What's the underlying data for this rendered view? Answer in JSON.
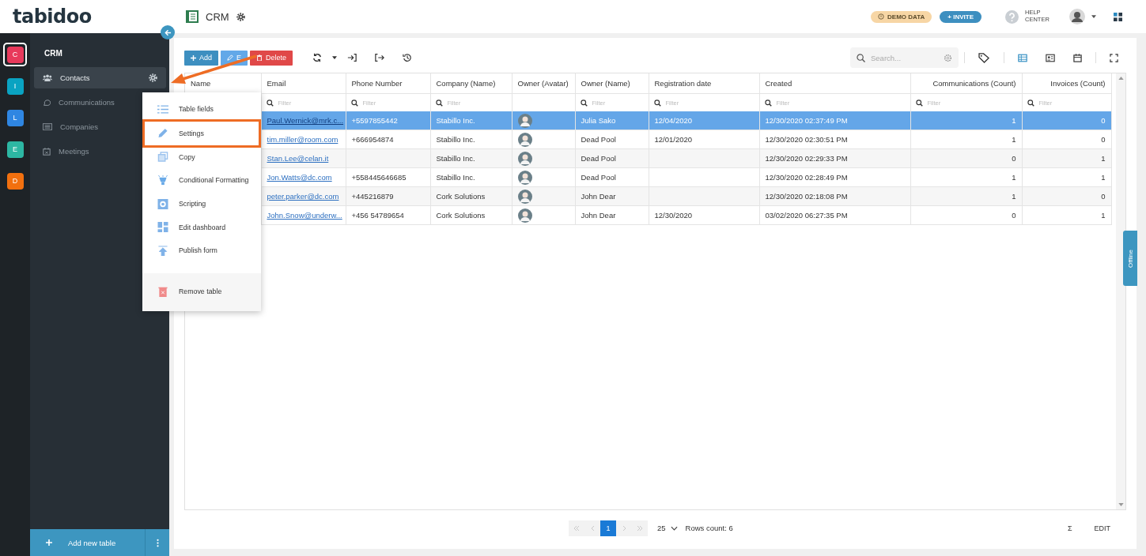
{
  "header": {
    "logo": "tabidoo",
    "app_title": "CRM",
    "demo_badge": "DEMO DATA",
    "invite_button": "+ INVITE",
    "help": "HELP CENTER"
  },
  "apps": [
    {
      "letter": "C",
      "color": "#e8395b",
      "selected": true
    },
    {
      "letter": "I",
      "color": "#0aa3c2",
      "selected": false
    },
    {
      "letter": "L",
      "color": "#2f86e2",
      "selected": false
    },
    {
      "letter": "E",
      "color": "#2db7a3",
      "selected": false
    },
    {
      "letter": "D",
      "color": "#f2700f",
      "selected": false
    }
  ],
  "nav": {
    "title": "CRM",
    "items": [
      {
        "label": "Contacts",
        "selected": true
      },
      {
        "label": "Communications",
        "selected": false
      },
      {
        "label": "Companies",
        "selected": false
      },
      {
        "label": "Meetings",
        "selected": false
      }
    ],
    "add_table": "Add new table"
  },
  "toolbar": {
    "buttons": [
      {
        "label": "Add",
        "kind": "add"
      },
      {
        "label": "E",
        "kind": "edit"
      },
      {
        "label": "Delete",
        "kind": "delete"
      }
    ],
    "search_placeholder": "Search..."
  },
  "menu": {
    "items": [
      {
        "label": "Table fields",
        "highlighted": false
      },
      {
        "label": "Settings",
        "highlighted": true
      },
      {
        "label": "Copy",
        "highlighted": false
      },
      {
        "label": "Conditional Formatting",
        "highlighted": false
      },
      {
        "label": "Scripting",
        "highlighted": false
      },
      {
        "label": "Edit dashboard",
        "highlighted": false
      },
      {
        "label": "Publish form",
        "highlighted": false
      }
    ],
    "footer_item": "Remove table"
  },
  "table": {
    "columns": [
      {
        "label": "Name"
      },
      {
        "label": "Email",
        "placeholder": "Filter"
      },
      {
        "label": "Phone Number",
        "placeholder": "Filter"
      },
      {
        "label": "Company (Name)",
        "placeholder": "Filter"
      },
      {
        "label": "Owner (Avatar)"
      },
      {
        "label": "Owner (Name)",
        "placeholder": "Filter"
      },
      {
        "label": "Registration date",
        "placeholder": "Filter"
      },
      {
        "label": "Created",
        "placeholder": "Filter"
      },
      {
        "label": "Communications (Count)",
        "placeholder": "Filter"
      },
      {
        "label": "Invoices (Count)",
        "placeholder": "Filter"
      }
    ],
    "rows": [
      {
        "selected": true,
        "email": "Paul.Wernick@mrk.c...",
        "phone": "+5597855442",
        "company": "Stabillo Inc.",
        "owner": "Julia Sako",
        "registration": "12/04/2020",
        "created": "12/30/2020 02:37:49 PM",
        "communications": "1",
        "invoices": "0"
      },
      {
        "selected": false,
        "email": "tim.miller@room.com",
        "phone": "+666954874",
        "company": "Stabillo Inc.",
        "owner": "Dead Pool",
        "registration": "12/01/2020",
        "created": "12/30/2020 02:30:51 PM",
        "communications": "1",
        "invoices": "0"
      },
      {
        "selected": false,
        "email": "Stan.Lee@celan.it",
        "company": "Stabillo Inc.",
        "owner": "Dead Pool",
        "created": "12/30/2020 02:29:33 PM",
        "communications": "0",
        "invoices": "1"
      },
      {
        "selected": false,
        "email": "Jon.Watts@dc.com",
        "phone": "+558445646685",
        "company": "Stabillo Inc.",
        "owner": "Dead Pool",
        "created": "12/30/2020 02:28:49 PM",
        "communications": "1",
        "invoices": "1"
      },
      {
        "selected": false,
        "email": "peter.parker@dc.com",
        "phone": "+445216879",
        "company": "Cork Solutions",
        "owner": "John Dear",
        "created": "12/30/2020 02:18:08 PM",
        "communications": "1",
        "invoices": "0"
      },
      {
        "selected": false,
        "email": "John.Snow@underw...",
        "phone": "+456 54789654",
        "company": "Cork Solutions",
        "owner": "John Dear",
        "registration": "12/30/2020",
        "created": "03/02/2020 06:27:35 PM",
        "communications": "0",
        "invoices": "1"
      }
    ]
  },
  "pager": {
    "pages": [
      {
        "label": "1",
        "selected": true
      }
    ],
    "page_size": "25",
    "rows_count": "Rows count: 6",
    "sum": "Σ",
    "edit": "EDIT"
  },
  "offline_tab": "Offline"
}
